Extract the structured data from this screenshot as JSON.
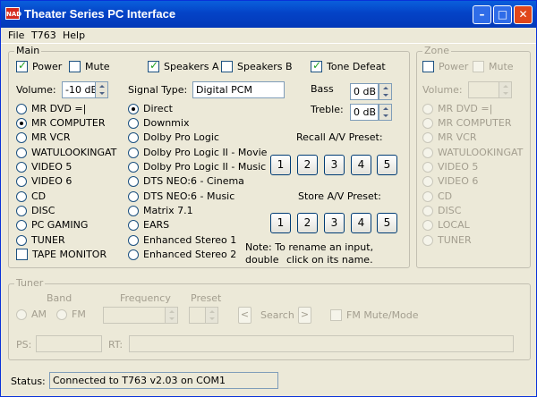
{
  "window": {
    "title": "Theater Series PC Interface",
    "icon_label": "NAD",
    "controls": {
      "minimize": "–",
      "maximize": "□",
      "close": "✕"
    }
  },
  "menu": [
    "File",
    "T763",
    "Help"
  ],
  "main": {
    "title": "Main",
    "power_label": "Power",
    "mute_label": "Mute",
    "speakers_a_label": "Speakers A",
    "speakers_b_label": "Speakers B",
    "tone_defeat_label": "Tone Defeat",
    "volume_label": "Volume:",
    "volume_value": "-10 dB",
    "signal_type_label": "Signal Type:",
    "signal_type_value": "Digital PCM",
    "bass_label": "Bass",
    "bass_value": "0 dB",
    "treble_label": "Treble:",
    "treble_value": "0 dB",
    "recall_label": "Recall A/V Preset:",
    "store_label": "Store A/V Preset:",
    "presets": [
      "1",
      "2",
      "3",
      "4",
      "5"
    ],
    "note_line1": "Note:  To rename an input, double",
    "note_line2": "click on its name.",
    "inputs": [
      "MR DVD =|",
      "MR COMPUTER",
      "MR VCR",
      "WATULOOKINGAT",
      "VIDEO 5",
      "VIDEO 6",
      "CD",
      "DISC",
      "PC GAMING",
      "TUNER"
    ],
    "tape_monitor_label": "TAPE MONITOR",
    "modes": [
      "Direct",
      "Downmix",
      "Dolby Pro Logic",
      "Dolby Pro Logic II - Movie",
      "Dolby Pro Logic II - Music",
      "DTS NEO:6 - Cinema",
      "DTS NEO:6 - Music",
      "Matrix 7.1",
      "EARS",
      "Enhanced Stereo 1",
      "Enhanced Stereo 2"
    ]
  },
  "zone": {
    "title": "Zone",
    "power_label": "Power",
    "mute_label": "Mute",
    "volume_label": "Volume:",
    "inputs": [
      "MR DVD =|",
      "MR COMPUTER",
      "MR VCR",
      "WATULOOKINGAT",
      "VIDEO 5",
      "VIDEO 6",
      "CD",
      "DISC",
      "LOCAL",
      "TUNER"
    ]
  },
  "tuner": {
    "title": "Tuner",
    "band_label": "Band",
    "am_label": "AM",
    "fm_label": "FM",
    "frequency_label": "Frequency",
    "preset_label": "Preset",
    "search_label": "Search",
    "search_prev": "<",
    "search_next": ">",
    "fm_mute_label": "FM Mute/Mode",
    "ps_label": "PS:",
    "rt_label": "RT:"
  },
  "status": {
    "label": "Status:",
    "value": "Connected to T763 v2.03 on COM1"
  }
}
